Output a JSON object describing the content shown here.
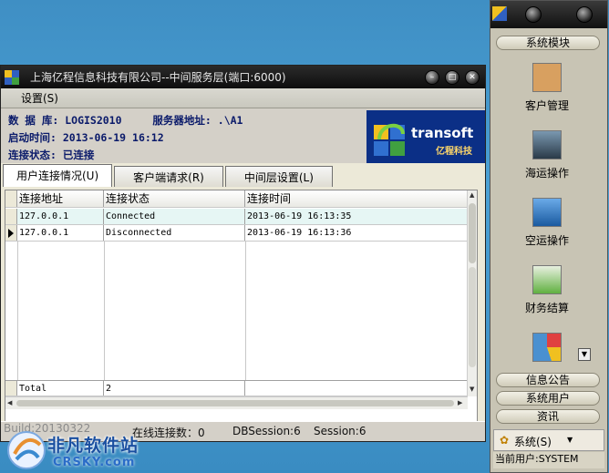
{
  "window": {
    "title": "上海亿程信息科技有限公司--中间服务层(端口:6000)",
    "menu": "设置(S)"
  },
  "info": {
    "db_label": "数 据 库:",
    "db_value": "LOGIS2010",
    "server_label": "服务器地址:",
    "server_value": ".\\A1",
    "start_label": "启动时间:",
    "start_value": "2013-06-19 16:12",
    "status_label": "连接状态:",
    "status_value": "已连接"
  },
  "logo": {
    "brand": "transoft",
    "brand_cn": "亿程科技"
  },
  "tabs": [
    {
      "label": "用户连接情况(U)"
    },
    {
      "label": "客户端请求(R)"
    },
    {
      "label": "中间层设置(L)"
    }
  ],
  "grid": {
    "columns": [
      "连接地址",
      "连接状态",
      "连接时间"
    ],
    "rows": [
      {
        "address": "127.0.0.1",
        "status": "Connected",
        "time": "2013-06-19 16:13:35"
      },
      {
        "address": "127.0.0.1",
        "status": "Disconnected",
        "time": "2013-06-19 16:13:36"
      }
    ],
    "footer": {
      "label": "Total",
      "value": "2"
    }
  },
  "statusbar": {
    "build": "Build:20130322",
    "online": "在线连接数：0",
    "dbsession": "DBSession:6",
    "session": "Session:6"
  },
  "side": {
    "header_button": "系统模块",
    "modules": [
      {
        "label": "客户管理",
        "color": "#d8a060"
      },
      {
        "label": "海运操作",
        "color": "#5a7890"
      },
      {
        "label": "空运操作",
        "color": "#3a7ac0"
      },
      {
        "label": "财务结算",
        "color": "#60b040"
      },
      {
        "label": "",
        "color": "#4a90d0"
      }
    ],
    "bottom_buttons": [
      "信息公告",
      "系统用户",
      "资讯"
    ],
    "system_menu": "系统(S)",
    "current_user": "当前用户:SYSTEM"
  },
  "watermark": {
    "cn": "非凡软件站",
    "en": "CRSKY.com"
  },
  "colors": {
    "title_bar": "#111111",
    "info_text": "#0a1a6a",
    "logo_bg": "#0b2f86",
    "selected_row": "#e6f6f4"
  }
}
